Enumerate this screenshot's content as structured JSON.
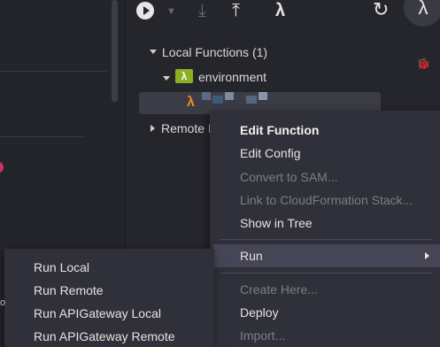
{
  "toolbar": {
    "play": "play-icon",
    "dropdown": "dropdown-icon",
    "download": "download-icon",
    "upload": "upload-icon",
    "sam": "sam-icon",
    "refresh": "refresh-icon",
    "lambda_glyph": "λ"
  },
  "tree": {
    "local_functions": "Local Functions (1)",
    "environment": "environment",
    "remote_prefix": "Remote I"
  },
  "glyphs": {
    "lambda": "λ",
    "folder_lambda": "λ",
    "bug": "🐞"
  },
  "blurred_function_name_colors": [
    "#5b6a86",
    "#3f5b7a",
    "#7d8aa0",
    "#5a6680",
    "#8a96ad"
  ],
  "context_menu": {
    "edit_function": "Edit Function",
    "edit_config": "Edit Config",
    "convert_to_sam": "Convert to SAM...",
    "link_cloudformation": "Link to CloudFormation Stack...",
    "show_in_tree": "Show in Tree",
    "run": "Run",
    "create_here": "Create Here...",
    "deploy": "Deploy",
    "import": "Import..."
  },
  "run_submenu": {
    "run_local": "Run Local",
    "run_remote": "Run Remote",
    "run_apigateway_local": "Run APIGateway Local",
    "run_apigateway_remote": "Run APIGateway Remote"
  },
  "left_peek": "o"
}
